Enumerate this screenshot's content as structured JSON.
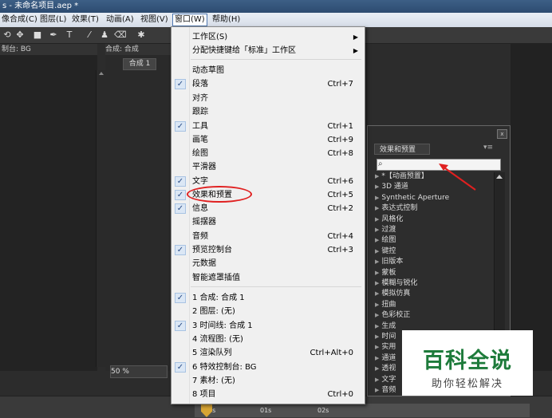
{
  "window": {
    "title": "s - 未命名项目.aep *"
  },
  "menubar": {
    "items": [
      {
        "label": "像合成(C)"
      },
      {
        "label": "图层(L)"
      },
      {
        "label": "效果(T)"
      },
      {
        "label": "动画(A)"
      },
      {
        "label": "视图(V)"
      },
      {
        "label": "窗口(W)",
        "active": true
      },
      {
        "label": "帮助(H)"
      }
    ]
  },
  "left_panel": {
    "header": "制台: BG"
  },
  "comp_panel": {
    "header": "合成: 合成",
    "tab": "合成 1",
    "zoom": "50 %"
  },
  "window_menu": {
    "items": [
      {
        "label": "工作区(S)",
        "submenu": true
      },
      {
        "label": "分配快捷键给「标准」工作区",
        "submenu": true
      },
      {
        "label": "动态草图"
      },
      {
        "label": "段落",
        "checked": true,
        "shortcut": "Ctrl+7"
      },
      {
        "label": "对齐"
      },
      {
        "label": "跟踪"
      },
      {
        "label": "工具",
        "checked": true,
        "shortcut": "Ctrl+1"
      },
      {
        "label": "画笔",
        "shortcut": "Ctrl+9"
      },
      {
        "label": "绘图",
        "shortcut": "Ctrl+8"
      },
      {
        "label": "平滑器"
      },
      {
        "label": "文字",
        "checked": true,
        "shortcut": "Ctrl+6"
      },
      {
        "label": "效果和预置",
        "checked": true,
        "shortcut": "Ctrl+5"
      },
      {
        "label": "信息",
        "checked": true,
        "shortcut": "Ctrl+2"
      },
      {
        "label": "摇摆器"
      },
      {
        "label": "音频",
        "shortcut": "Ctrl+4"
      },
      {
        "label": "预览控制台",
        "checked": true,
        "shortcut": "Ctrl+3"
      },
      {
        "label": "元数据"
      },
      {
        "label": "智能遮罩插值"
      },
      {
        "label": "1 合成: 合成 1",
        "checked": true
      },
      {
        "label": "2 图层: (无)"
      },
      {
        "label": "3 时间线: 合成 1",
        "checked": true
      },
      {
        "label": "4 流程图: (无)"
      },
      {
        "label": "5 渲染队列",
        "shortcut": "Ctrl+Alt+0"
      },
      {
        "label": "6 特效控制台: BG",
        "checked": true
      },
      {
        "label": "7 素材: (无)"
      },
      {
        "label": "8 项目",
        "shortcut": "Ctrl+0"
      }
    ]
  },
  "effects_panel": {
    "tab": "效果和预置",
    "search_icon": "search-icon",
    "items": [
      "*【动画预置】",
      "3D 通道",
      "Synthetic Aperture",
      "表达式控制",
      "风格化",
      "过渡",
      "绘图",
      "键控",
      "旧版本",
      "蒙板",
      "模糊与锐化",
      "模拟仿真",
      "扭曲",
      "色彩校正",
      "生成",
      "时间",
      "实用",
      "通道",
      "透视",
      "文字",
      "音频"
    ]
  },
  "timeline": {
    "ruler_labels": [
      "00s",
      "01s",
      "02s"
    ]
  },
  "watermark": {
    "title": "百科全说",
    "subtitle": "助你轻松解决"
  },
  "colors": {
    "menu_highlight_oval": "#e02020",
    "annotation_arrow": "#e02020",
    "watermark_green": "#1e7b3b"
  }
}
